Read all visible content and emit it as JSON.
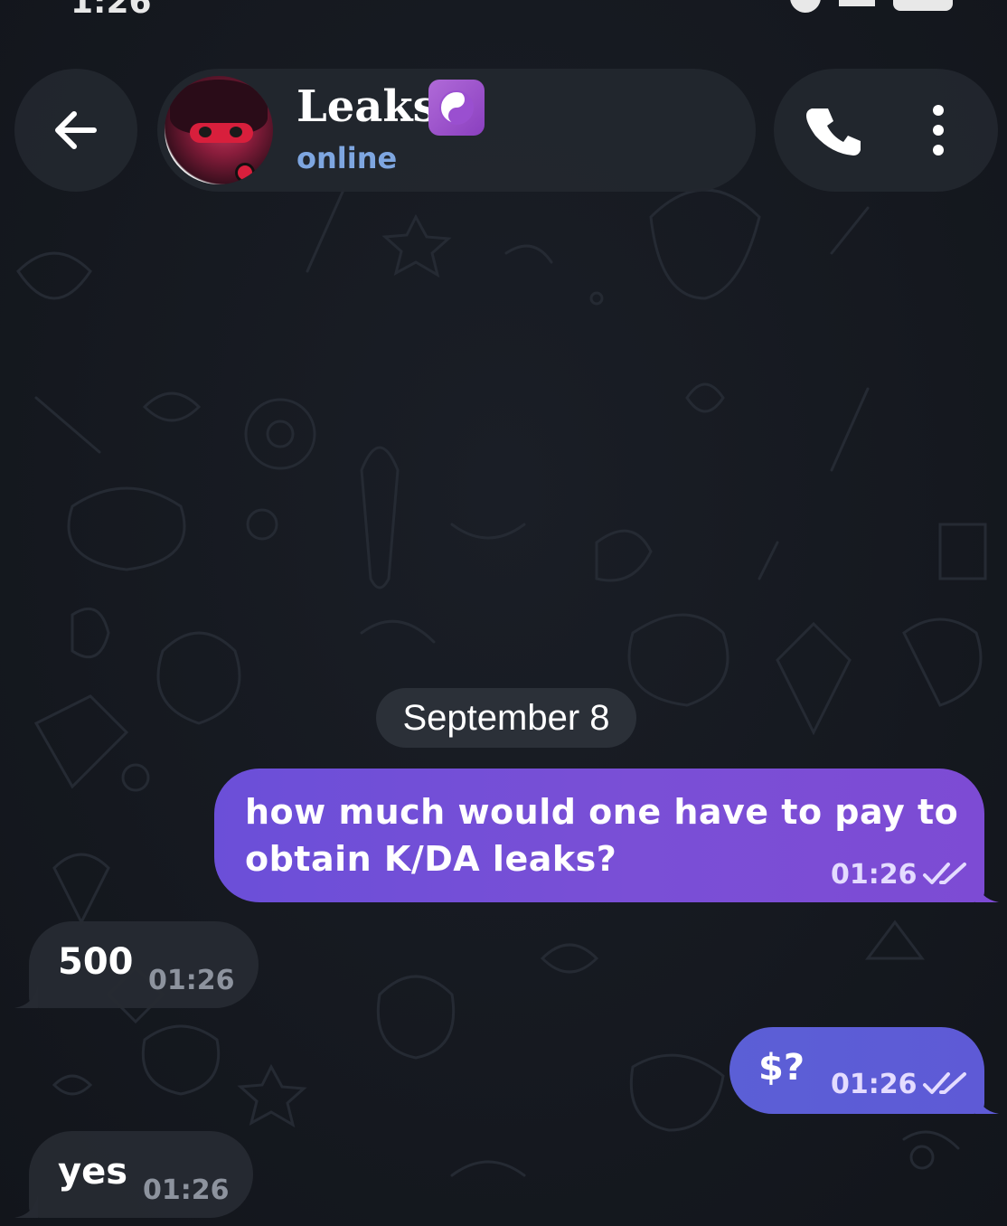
{
  "status_bar": {
    "time": "1:26"
  },
  "header": {
    "back_icon": "arrow-left-icon",
    "contact_name": "Leaks",
    "contact_emoji": "yin-yang-icon",
    "contact_status": "online",
    "call_icon": "phone-icon",
    "menu_icon": "more-vertical-icon"
  },
  "date_separator": "September 8",
  "messages": [
    {
      "direction": "outgoing",
      "text": "how much would one have to pay to obtain K/DA leaks?",
      "time": "01:26",
      "read": true
    },
    {
      "direction": "incoming",
      "text": "500",
      "time": "01:26"
    },
    {
      "direction": "outgoing",
      "text": "$?",
      "time": "01:26",
      "read": true
    },
    {
      "direction": "incoming",
      "text": "yes",
      "time": "01:26"
    }
  ],
  "colors": {
    "background": "#15181f",
    "header_pill": "#22262e",
    "outgoing_bubble": "#7a4fd6",
    "outgoing_bubble_alt": "#5e5ad6",
    "incoming_bubble": "#262a32",
    "status_online": "#7ea6e0"
  }
}
